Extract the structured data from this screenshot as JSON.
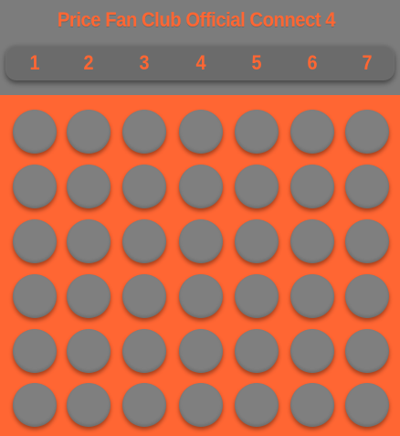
{
  "header": {
    "title": "Price Fan Club Official Connect 4"
  },
  "columns": [
    {
      "label": "1"
    },
    {
      "label": "2"
    },
    {
      "label": "3"
    },
    {
      "label": "4"
    },
    {
      "label": "5"
    },
    {
      "label": "6"
    },
    {
      "label": "7"
    }
  ],
  "board": {
    "rows": 6,
    "cols": 7,
    "cells": [
      [
        "empty",
        "empty",
        "empty",
        "empty",
        "empty",
        "empty",
        "empty"
      ],
      [
        "empty",
        "empty",
        "empty",
        "empty",
        "empty",
        "empty",
        "empty"
      ],
      [
        "empty",
        "empty",
        "empty",
        "empty",
        "empty",
        "empty",
        "empty"
      ],
      [
        "empty",
        "empty",
        "empty",
        "empty",
        "empty",
        "empty",
        "empty"
      ],
      [
        "empty",
        "empty",
        "empty",
        "empty",
        "empty",
        "empty",
        "empty"
      ],
      [
        "empty",
        "empty",
        "empty",
        "empty",
        "empty",
        "empty",
        "empty"
      ]
    ]
  },
  "colors": {
    "accent": "#ff6633",
    "header_bg": "#7c7c7c",
    "bar_bg": "#6b6b6b",
    "empty_hole": "#7f7f7f"
  }
}
